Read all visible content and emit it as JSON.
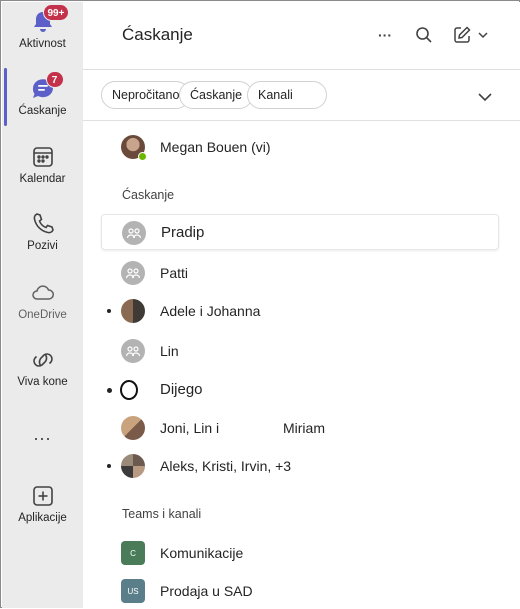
{
  "rail": {
    "items": [
      {
        "label": "Aktivnost",
        "badge": "99+"
      },
      {
        "label": "Ćaskanje",
        "badge": "7"
      },
      {
        "label": "Kalendar"
      },
      {
        "label": "Pozivi"
      },
      {
        "label": "OneDrive"
      },
      {
        "label": "Viva kone"
      },
      {
        "label": "..."
      },
      {
        "label": "Aplikacije"
      }
    ]
  },
  "header": {
    "title": "Ćaskanje",
    "more_glyph": "···"
  },
  "filters": [
    "Nepročitano",
    "Ćaskanje",
    "Kanali"
  ],
  "self": {
    "name": "Megan Bouen (vi)"
  },
  "sections": {
    "chats": "Ćaskanje",
    "teams": "Teams i kanali"
  },
  "chats": [
    {
      "name": "Pradip",
      "avatar": "group-icon",
      "selected": true
    },
    {
      "name": "Patti",
      "avatar": "group-icon"
    },
    {
      "name": "Adele i Johanna",
      "avatar": "photo",
      "unread": true
    },
    {
      "name": "Lin",
      "avatar": "group-icon"
    },
    {
      "name": "Dijego",
      "avatar": "circle",
      "unread": true
    },
    {
      "name": "Joni, Lin i",
      "name_suffix": "Miriam",
      "avatar": "photo"
    },
    {
      "name": "Aleks, Kristi, Irvin, +3",
      "avatar": "photo",
      "unread": true
    }
  ],
  "teams": [
    {
      "name": "Komunikacije",
      "initials": "C",
      "color": "#4a7c59"
    },
    {
      "name": "Prodaja u SAD",
      "initials": "US",
      "color": "#5a7f8a"
    }
  ],
  "colors": {
    "accent": "#5b5fc7",
    "badge": "#c4314b",
    "rail_bg": "#ebebeb",
    "presence": "#6bb700"
  }
}
